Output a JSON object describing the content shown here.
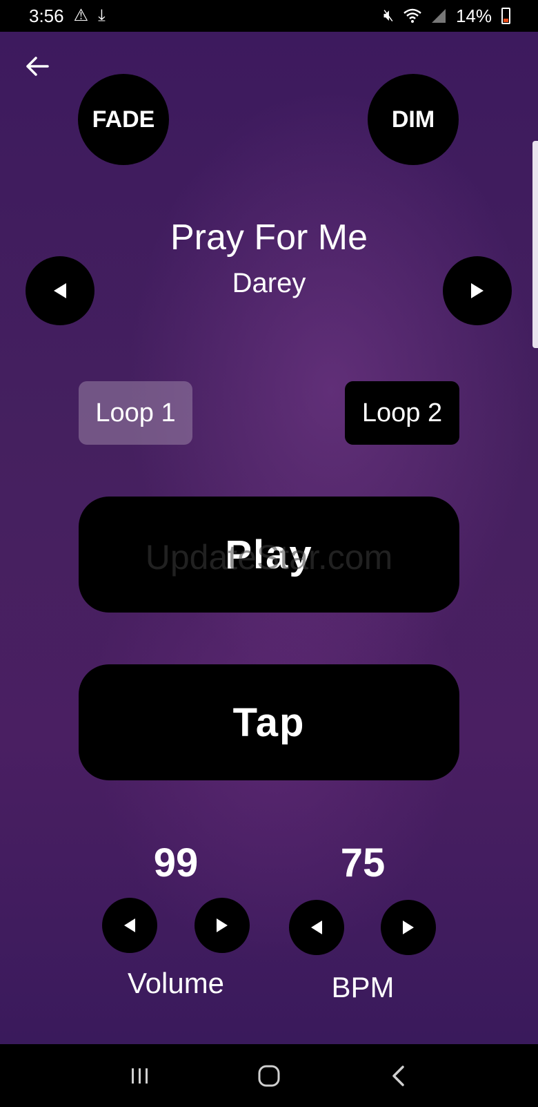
{
  "status_bar": {
    "time": "3:56",
    "battery": "14%"
  },
  "player": {
    "fade_label": "FADE",
    "dim_label": "DIM",
    "song_title": "Pray For Me",
    "artist": "Darey",
    "loop1_label": "Loop 1",
    "loop2_label": "Loop 2",
    "play_label": "Play",
    "tap_label": "Tap"
  },
  "controls": {
    "volume_value": "99",
    "volume_label": "Volume",
    "bpm_value": "75",
    "bpm_label": "BPM"
  },
  "watermark": "UpdateStar.com",
  "colors": {
    "background": "#45205f",
    "button": "#000000",
    "text": "#ffffff",
    "loop_active": "#a996b4"
  }
}
